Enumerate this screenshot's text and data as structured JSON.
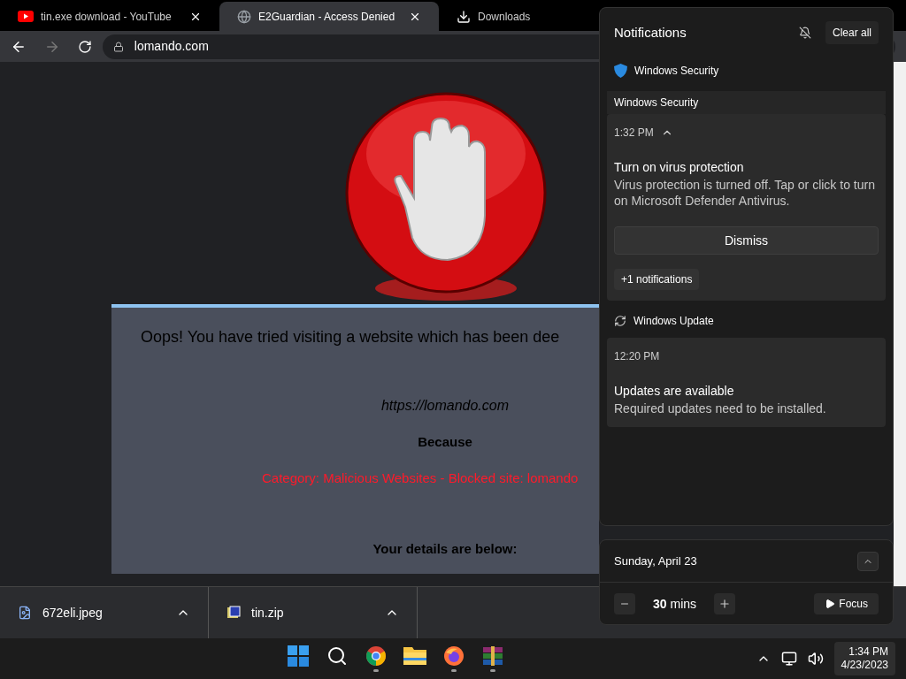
{
  "browser": {
    "tabs": [
      {
        "title": "tin.exe download - YouTube",
        "kind": "youtube",
        "selected": false,
        "closable": true
      },
      {
        "title": "E2Guardian - Access Denied",
        "kind": "page",
        "selected": true,
        "closable": true
      },
      {
        "title": "Downloads",
        "kind": "downloads",
        "selected": false,
        "closable": false
      }
    ],
    "address": "lomando.com"
  },
  "page": {
    "heading": "Oops! You have tried visiting a website which has been dee",
    "url": "https://lomando.com",
    "because": "Because",
    "reason": "Category: Malicious Websites - Blocked site: lomando",
    "details": "Your details are below:"
  },
  "downloads": [
    {
      "name": "672eli.jpeg",
      "kind": "image"
    },
    {
      "name": "tin.zip",
      "kind": "archive"
    }
  ],
  "notifications": {
    "title": "Notifications",
    "clear": "Clear all",
    "groups": [
      {
        "app": "Windows Security",
        "kind": "security",
        "header": "Windows Security",
        "items": [
          {
            "time": "1:32 PM",
            "expanded": true,
            "title": "Turn on virus protection",
            "body": "Virus protection is turned off. Tap or click to turn on Microsoft Defender Antivirus.",
            "action": "Dismiss",
            "more": "+1 notifications"
          }
        ]
      },
      {
        "app": "Windows Update",
        "kind": "update",
        "items": [
          {
            "time": "12:20 PM",
            "title": "Updates are available",
            "body": "Required updates need to be installed."
          }
        ]
      }
    ]
  },
  "calendar": {
    "date": "Sunday, April 23",
    "minutes": "30",
    "unit": "mins",
    "focus": "Focus"
  },
  "taskbar": {
    "apps": [
      {
        "kind": "start",
        "running": false
      },
      {
        "kind": "search",
        "running": false
      },
      {
        "kind": "chrome",
        "running": true
      },
      {
        "kind": "files",
        "running": false
      },
      {
        "kind": "firefox",
        "running": true
      },
      {
        "kind": "winrar",
        "running": true
      }
    ],
    "time": "1:34 PM",
    "date": "4/23/2023"
  }
}
